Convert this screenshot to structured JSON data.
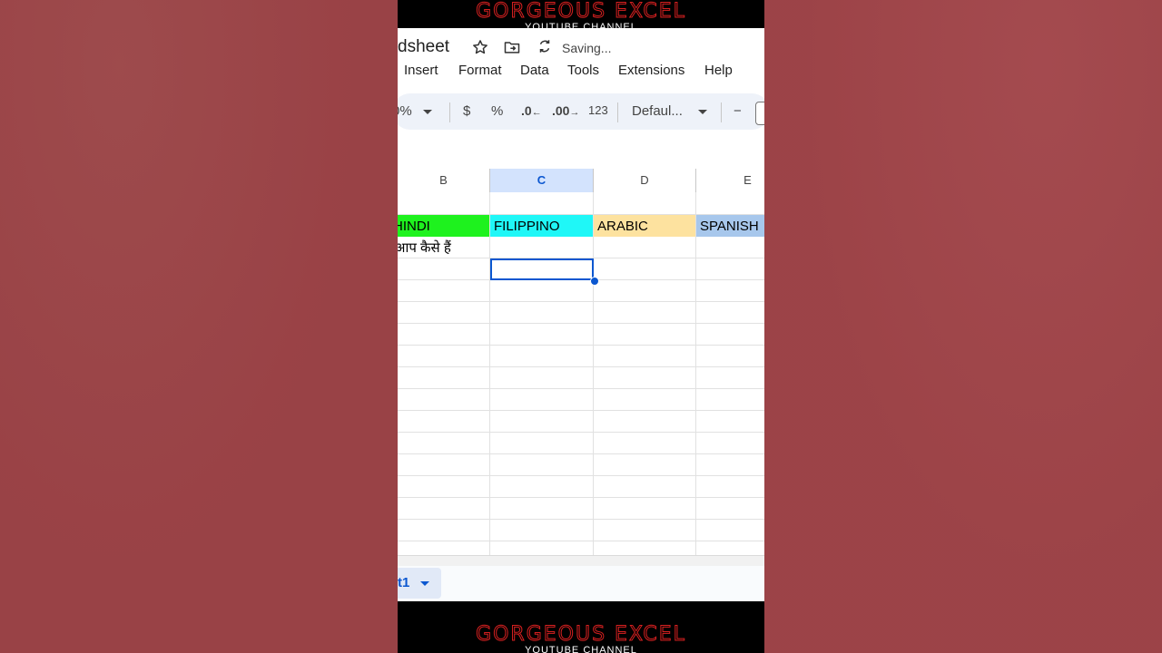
{
  "watermark": {
    "brand": "GORGEOUS EXCEL",
    "subtitle": "YOUTUBE CHANNEL",
    "stroke_color": "#d62020"
  },
  "title_bar": {
    "doc_title": "dsheet",
    "status": "Saving...",
    "icons": [
      "star-icon",
      "move-to-folder-icon",
      "sync-icon"
    ]
  },
  "menu": [
    "Insert",
    "Format",
    "Data",
    "Tools",
    "Extensions",
    "Help"
  ],
  "toolbar": {
    "zoom": "0%",
    "currency": "$",
    "percent": "%",
    "decrease_decimal": ".0",
    "increase_decimal": ".00",
    "number_format": "123",
    "font": "Defaul...",
    "font_size_minus": "−"
  },
  "columns": [
    {
      "label": "B",
      "selected": false
    },
    {
      "label": "C",
      "selected": true
    },
    {
      "label": "D",
      "selected": false
    },
    {
      "label": "E",
      "selected": false
    }
  ],
  "rows": {
    "header": {
      "B": {
        "text": "HINDI",
        "bg": "#1ef21e"
      },
      "C": {
        "text": "FILIPPINO",
        "bg": "#1ff7f7"
      },
      "D": {
        "text": "ARABIC",
        "bg": "#fde29f"
      },
      "E": {
        "text": "SPANISH",
        "bg": "#a7c7ec"
      }
    },
    "row2_B": "आप कैसे हैं"
  },
  "selected_cell": "C4",
  "sheet_tab": {
    "label": "t1"
  },
  "colors": {
    "accent": "#0b57d0",
    "selected_header_bg": "#d3e3fd",
    "toolbar_bg": "#eef2f9"
  }
}
